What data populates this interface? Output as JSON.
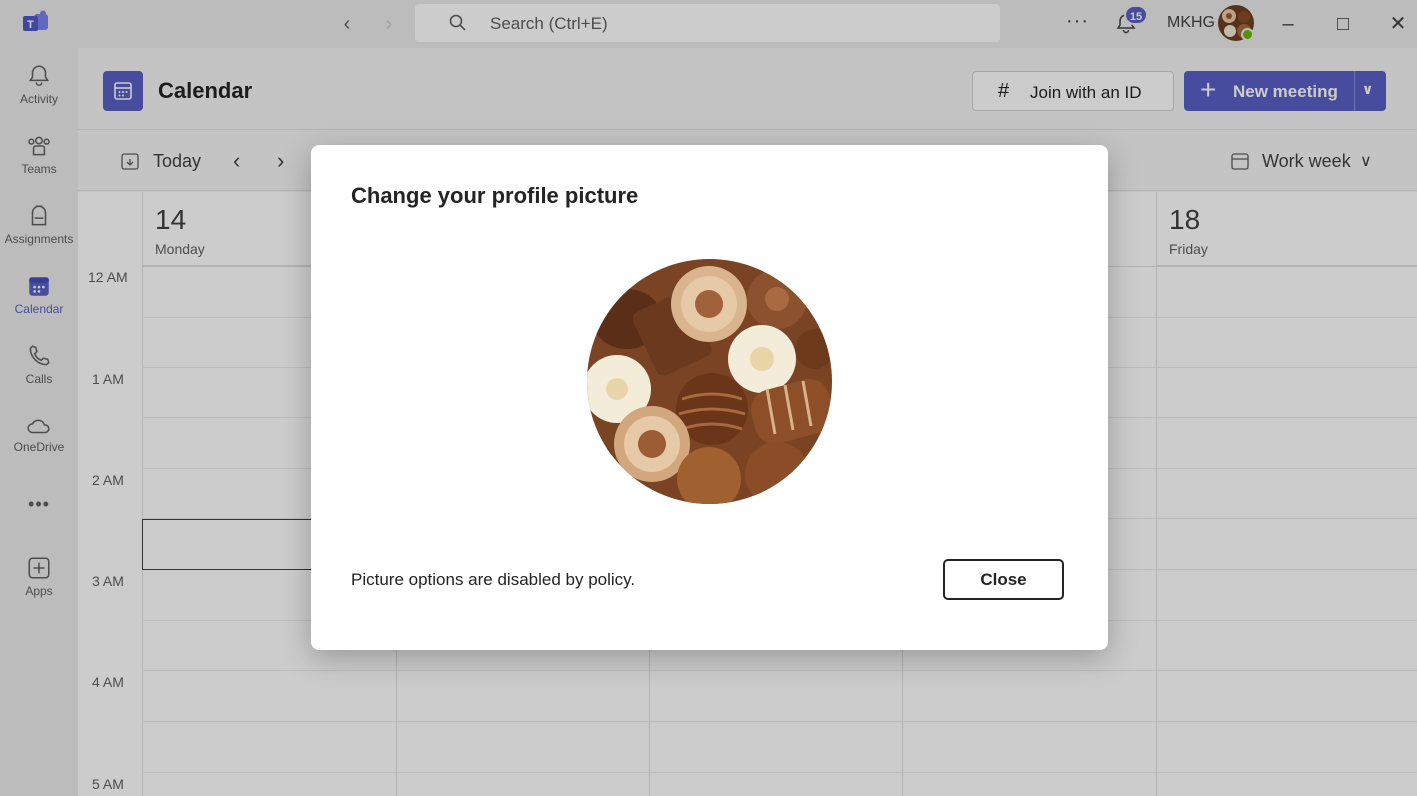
{
  "titlebar": {
    "search_placeholder": "Search (Ctrl+E)",
    "notification_count": "15",
    "org_name": "MKHG",
    "more_label": "···"
  },
  "rail": {
    "items": [
      {
        "label": "Activity",
        "icon": "bell-icon"
      },
      {
        "label": "Teams",
        "icon": "teams-icon"
      },
      {
        "label": "Assignments",
        "icon": "backpack-icon"
      },
      {
        "label": "Calendar",
        "icon": "calendar-icon"
      },
      {
        "label": "Calls",
        "icon": "phone-icon"
      },
      {
        "label": "OneDrive",
        "icon": "cloud-icon"
      },
      {
        "label": "Apps",
        "icon": "add-app-icon"
      }
    ],
    "more_label": "•••"
  },
  "header": {
    "title": "Calendar",
    "join_label": "Join with an ID",
    "new_meeting_label": "New meeting"
  },
  "toolbar": {
    "today_label": "Today",
    "view_label": "Work week"
  },
  "grid": {
    "days": [
      {
        "num": "14",
        "name": "Monday"
      },
      {
        "num": "18",
        "name": "Friday"
      }
    ],
    "times": [
      "12 AM",
      "1 AM",
      "2 AM",
      "3 AM",
      "4 AM",
      "5 AM"
    ]
  },
  "dialog": {
    "title": "Change your profile picture",
    "message": "Picture options are disabled by policy.",
    "close_label": "Close"
  },
  "colors": {
    "accent": "#5b5fc7",
    "presence": "#6bb700"
  }
}
